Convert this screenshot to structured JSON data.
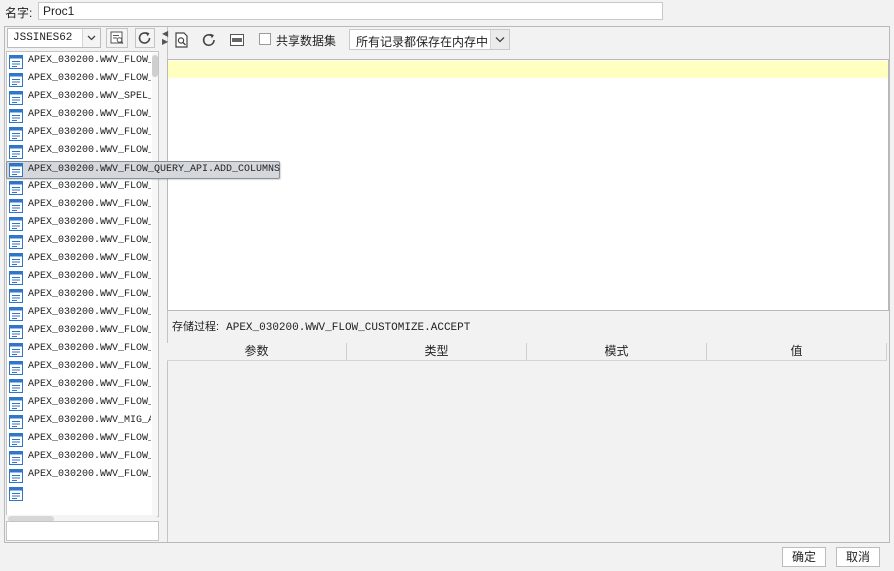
{
  "name_row": {
    "label": "名字:",
    "value": "Proc1"
  },
  "left": {
    "datasource": "JSSINES62",
    "items": [
      "APEX_030200.WWV_FLOW_",
      "APEX_030200.WWV_FLOW_",
      "APEX_030200.WWV_SPEL_",
      "APEX_030200.WWV_FLOW_",
      "APEX_030200.WWV_FLOW_",
      "APEX_030200.WWV_FLOW_",
      "",
      "APEX_030200.WWV_FLOW_",
      "APEX_030200.WWV_FLOW_",
      "APEX_030200.WWV_FLOW_",
      "APEX_030200.WWV_FLOW_",
      "APEX_030200.WWV_FLOW_",
      "APEX_030200.WWV_FLOW_",
      "APEX_030200.WWV_FLOW_",
      "APEX_030200.WWV_FLOW_",
      "APEX_030200.WWV_FLOW_",
      "APEX_030200.WWV_FLOW_",
      "APEX_030200.WWV_FLOW_",
      "APEX_030200.WWV_FLOW_",
      "APEX_030200.WWV_FLOW_",
      "APEX_030200.WWV_MIG_A",
      "APEX_030200.WWV_FLOW_",
      "APEX_030200.WWV_FLOW_",
      "APEX_030200.WWV_FLOW_"
    ],
    "popup_text": "APEX_030200.WWV_FLOW_QUERY_API.ADD_COLUMNS",
    "search_value": ""
  },
  "toolbar": {
    "share_label": "共享数据集",
    "mode_value": "所有记录都保存在内存中"
  },
  "procedure": {
    "label": "存储过程:",
    "value": "APEX_030200.WWV_FLOW_CUSTOMIZE.ACCEPT"
  },
  "params": {
    "columns": [
      "参数",
      "类型",
      "模式",
      "值"
    ]
  },
  "buttons": {
    "ok": "确定",
    "cancel": "取消"
  },
  "colors": {
    "editor_highlight": "#ffffc0",
    "icon_blue": "#2f76c9"
  }
}
